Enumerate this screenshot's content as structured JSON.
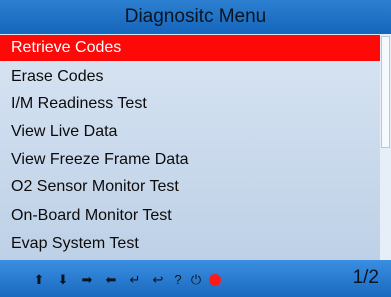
{
  "header": {
    "title": "Diagnositc Menu"
  },
  "menu": {
    "items": [
      {
        "label": "Retrieve Codes",
        "selected": true
      },
      {
        "label": "Erase Codes"
      },
      {
        "label": "I/M Readiness Test"
      },
      {
        "label": "View Live Data"
      },
      {
        "label": "View Freeze Frame Data"
      },
      {
        "label": "O2 Sensor Monitor Test"
      },
      {
        "label": "On-Board Monitor Test"
      },
      {
        "label": "Evap System Test"
      }
    ]
  },
  "footer": {
    "keys": [
      {
        "icon": "arrow-up-icon",
        "glyph": "⬆"
      },
      {
        "icon": "arrow-down-icon",
        "glyph": "⬇"
      },
      {
        "icon": "arrow-right-icon",
        "glyph": "➡"
      },
      {
        "icon": "arrow-left-icon",
        "glyph": "⬅"
      },
      {
        "icon": "enter-icon",
        "glyph": "↵"
      },
      {
        "icon": "back-icon",
        "glyph": "↩"
      },
      {
        "icon": "help-icon",
        "glyph": "?"
      },
      {
        "icon": "power-icon",
        "glyph": "⏻"
      }
    ],
    "record_icon": "record-dot-icon",
    "page": "1/2"
  },
  "colors": {
    "title_bar": "#1566bc",
    "selected_row": "#ff0808",
    "bottom_bar": "#1a6ac0",
    "record_dot": "#ff1a1a"
  }
}
